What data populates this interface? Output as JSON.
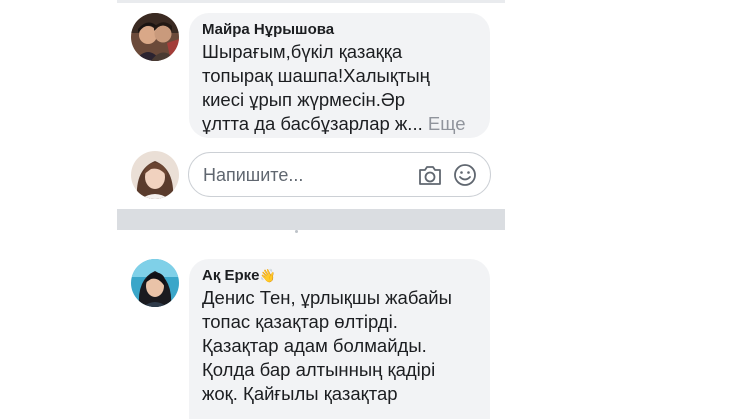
{
  "comment1": {
    "author": "Майра Нұрышова",
    "text": "Шырағым,бүкіл қазаққа\nтопырақ шашпа!Халықтың\nкиесі ұрып жүрмесін.Әр\nұлтта да басбұзарлар ж...",
    "see_more": "Еще"
  },
  "composer": {
    "placeholder": "Напишите...",
    "camera_icon": "camera-icon",
    "emoji_icon": "emoji-icon"
  },
  "comment2": {
    "author": "Ақ Ерке",
    "author_emoji": "👋",
    "text": "Денис Тен, ұрлықшы жабайы\nтопас қазақтар өлтірді.\nҚазақтар адам болмайды.\nҚолда бар алтынның қадірі\nжоқ. Қайғылы қазақтар"
  },
  "colors": {
    "bubble": "#f2f3f5",
    "text": "#1c1e21",
    "muted": "#90949c",
    "divider": "#dadde1"
  }
}
